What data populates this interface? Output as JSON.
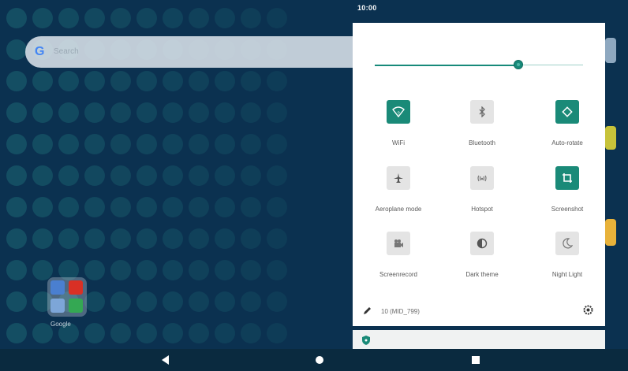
{
  "status_bar": {
    "time": "10:00"
  },
  "home": {
    "search_hint": "Search",
    "google_logo": "G",
    "folder_label": "Google"
  },
  "quick_settings": {
    "brightness_level": 0.69,
    "tiles": [
      {
        "label": "WiFi",
        "icon": "wifi-icon",
        "state": "on"
      },
      {
        "label": "Bluetooth",
        "icon": "bluetooth-icon",
        "state": "off"
      },
      {
        "label": "Auto-rotate",
        "icon": "auto-rotate-icon",
        "state": "on"
      },
      {
        "label": "Aeroplane mode",
        "icon": "aeroplane-icon",
        "state": "off"
      },
      {
        "label": "Hotspot",
        "icon": "hotspot-icon",
        "state": "off"
      },
      {
        "label": "Screenshot",
        "icon": "screenshot-icon",
        "state": "on"
      },
      {
        "label": "Screenrecord",
        "icon": "screenrecord-icon",
        "state": "off"
      },
      {
        "label": "Dark theme",
        "icon": "dark-theme-icon",
        "state": "off"
      },
      {
        "label": "Night Light",
        "icon": "night-light-icon",
        "state": "off"
      }
    ],
    "build_number": "10 (MID_799)"
  },
  "colors": {
    "accent": "#1a8a78",
    "wallpaper": "#0b3150",
    "panel": "#ffffff"
  },
  "nav": {
    "back": "back-icon",
    "home": "home-icon",
    "recents": "recents-icon"
  }
}
